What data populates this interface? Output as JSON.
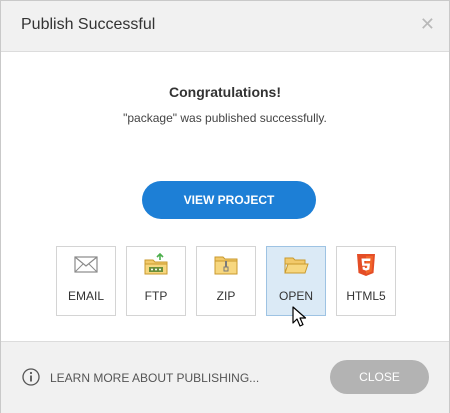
{
  "dialog": {
    "title": "Publish Successful",
    "close_glyph": "✕"
  },
  "message": {
    "heading": "Congratulations!",
    "detail": "\"package\" was published successfully."
  },
  "primary_action": {
    "label": "VIEW PROJECT",
    "color": "#1d7fd6"
  },
  "options": [
    {
      "label": "EMAIL",
      "icon": "envelope-icon"
    },
    {
      "label": "FTP",
      "icon": "ftp-folder-icon"
    },
    {
      "label": "ZIP",
      "icon": "zip-folder-icon"
    },
    {
      "label": "OPEN",
      "icon": "open-folder-icon",
      "selected": true
    },
    {
      "label": "HTML5",
      "icon": "html5-icon"
    }
  ],
  "footer": {
    "learn_label": "LEARN MORE ABOUT PUBLISHING...",
    "close_label": "CLOSE"
  }
}
